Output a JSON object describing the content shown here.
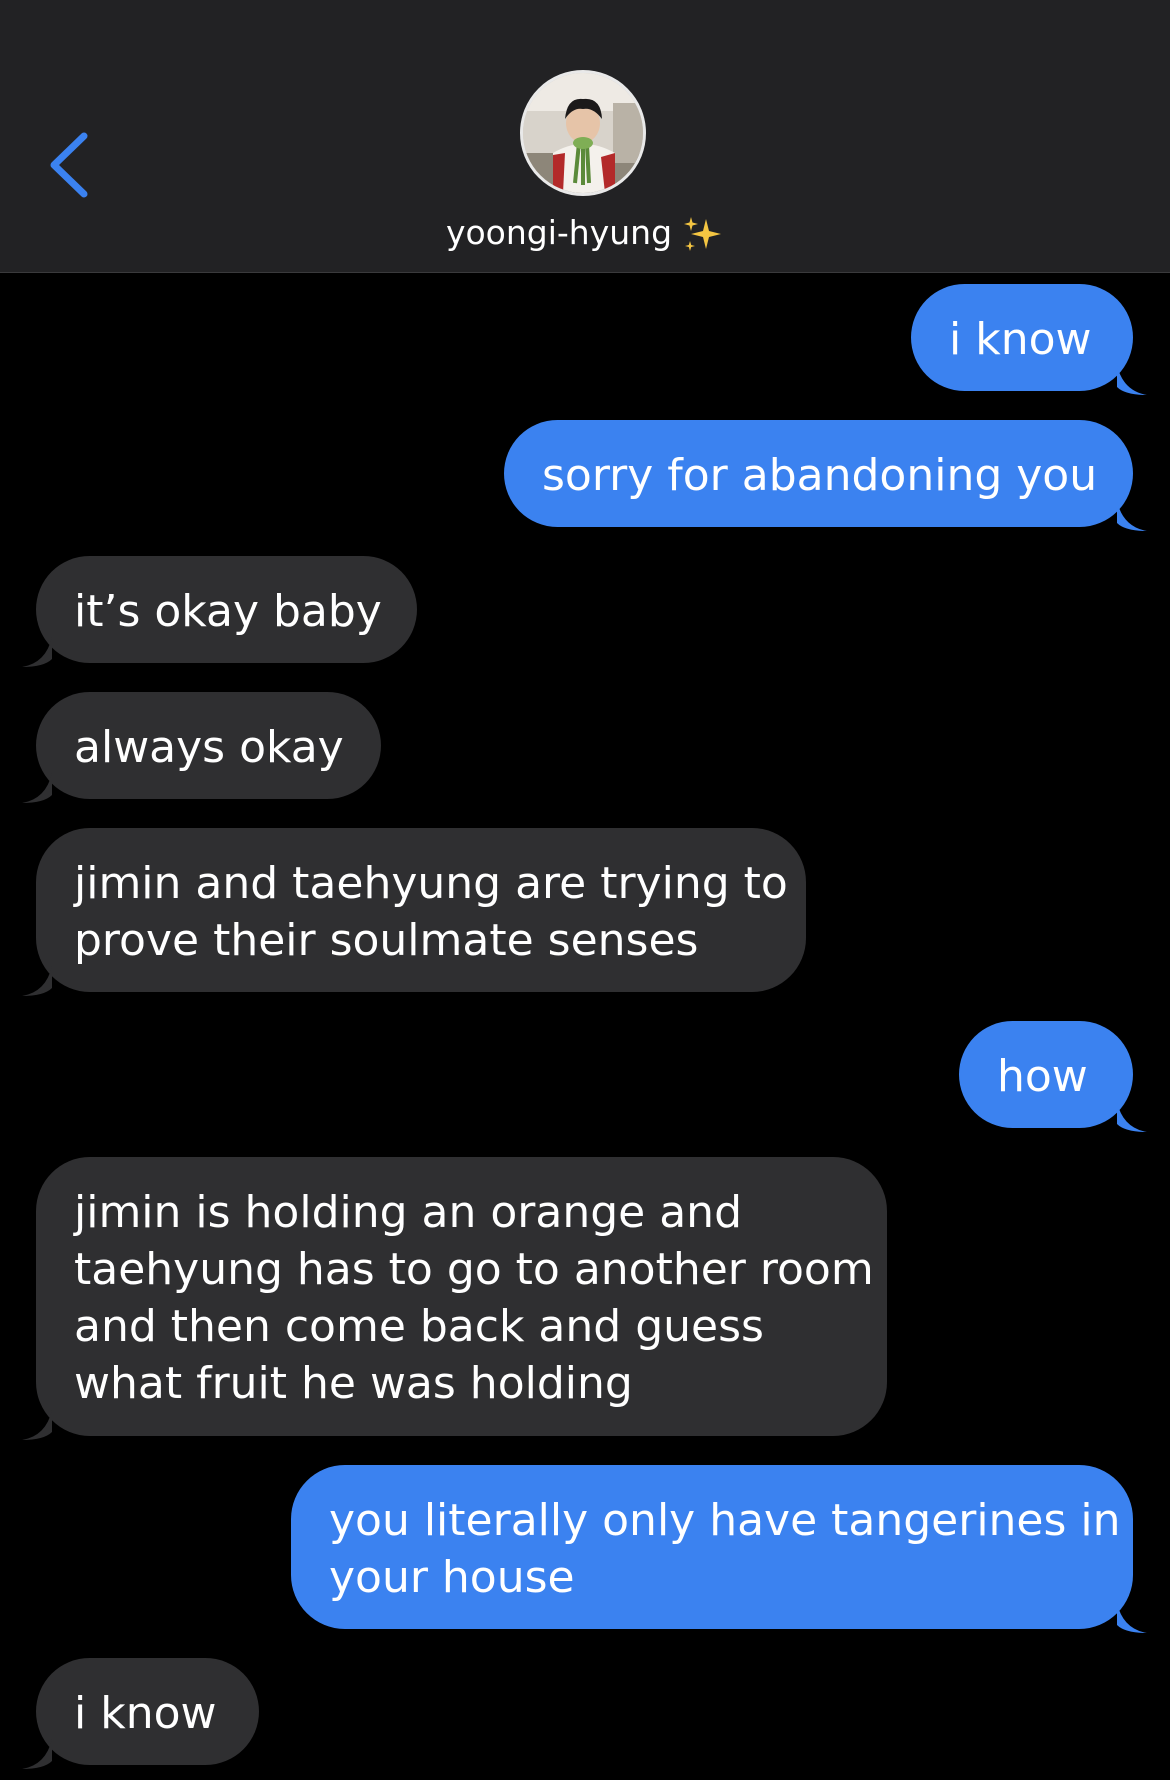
{
  "header": {
    "back_icon": "chevron-left-icon",
    "avatar_icon": "contact-photo",
    "contact_name": "yoongi-hyung",
    "contact_emoji_icon": "sparkles-icon",
    "accent_color": "#3b82f0"
  },
  "messages": [
    {
      "direction": "outgoing",
      "text": "i know"
    },
    {
      "direction": "outgoing",
      "text": "sorry for abandoning you"
    },
    {
      "direction": "incoming",
      "text": "it’s okay baby"
    },
    {
      "direction": "incoming",
      "text": "always okay"
    },
    {
      "direction": "incoming",
      "lines": [
        "jimin and taehyung are trying to",
        "prove their soulmate senses"
      ]
    },
    {
      "direction": "outgoing",
      "text": "how"
    },
    {
      "direction": "incoming",
      "lines": [
        "jimin is holding an orange and",
        "taehyung has to go to another room",
        "and then come back and guess",
        "what fruit he was holding"
      ]
    },
    {
      "direction": "outgoing",
      "lines": [
        "you literally only have tangerines in",
        "your house"
      ]
    },
    {
      "direction": "incoming",
      "text": "i know"
    }
  ],
  "colors": {
    "outgoing_bubble": "#3b82f0",
    "incoming_bubble": "#2f2f31",
    "header_bg": "#222224",
    "background": "#000000"
  }
}
